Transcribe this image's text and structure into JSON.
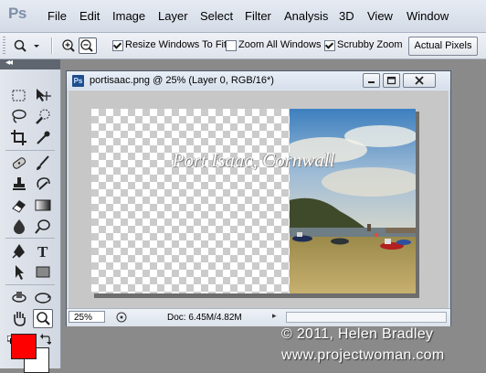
{
  "app": {
    "logo_text": "Ps"
  },
  "menu": [
    "File",
    "Edit",
    "Image",
    "Layer",
    "Select",
    "Filter",
    "Analysis",
    "3D",
    "View",
    "Window"
  ],
  "options_bar": {
    "resize_windows_label": "Resize Windows To Fit",
    "resize_windows_checked": true,
    "zoom_all_windows_label": "Zoom All Windows",
    "zoom_all_windows_checked": false,
    "scrubby_zoom_label": "Scrubby Zoom",
    "scrubby_zoom_checked": true,
    "actual_pixels_label": "Actual Pixels"
  },
  "document": {
    "title": "portisaac.png @ 25% (Layer 0, RGB/16*)",
    "overlay_text": "Port Isaac, Cornwall",
    "zoom": "25%",
    "doc_size": "Doc: 6.45M/4.82M"
  },
  "colors": {
    "foreground": "#ff0000",
    "background": "#ffffff"
  },
  "tools": [
    "marquee-tool",
    "move-tool",
    "lasso-tool",
    "quick-selection-tool",
    "crop-tool",
    "eyedropper-tool",
    "spot-healing-tool",
    "brush-tool",
    "clone-stamp-tool",
    "history-brush-tool",
    "eraser-tool",
    "gradient-tool",
    "blur-tool",
    "dodge-tool",
    "pen-tool",
    "type-tool",
    "path-selection-tool",
    "rectangle-tool",
    "3d-rotate-tool",
    "3d-orbit-tool",
    "hand-tool",
    "zoom-tool"
  ],
  "watermark": {
    "line1": "© 2011, Helen Bradley",
    "line2": "www.projectwoman.com"
  }
}
